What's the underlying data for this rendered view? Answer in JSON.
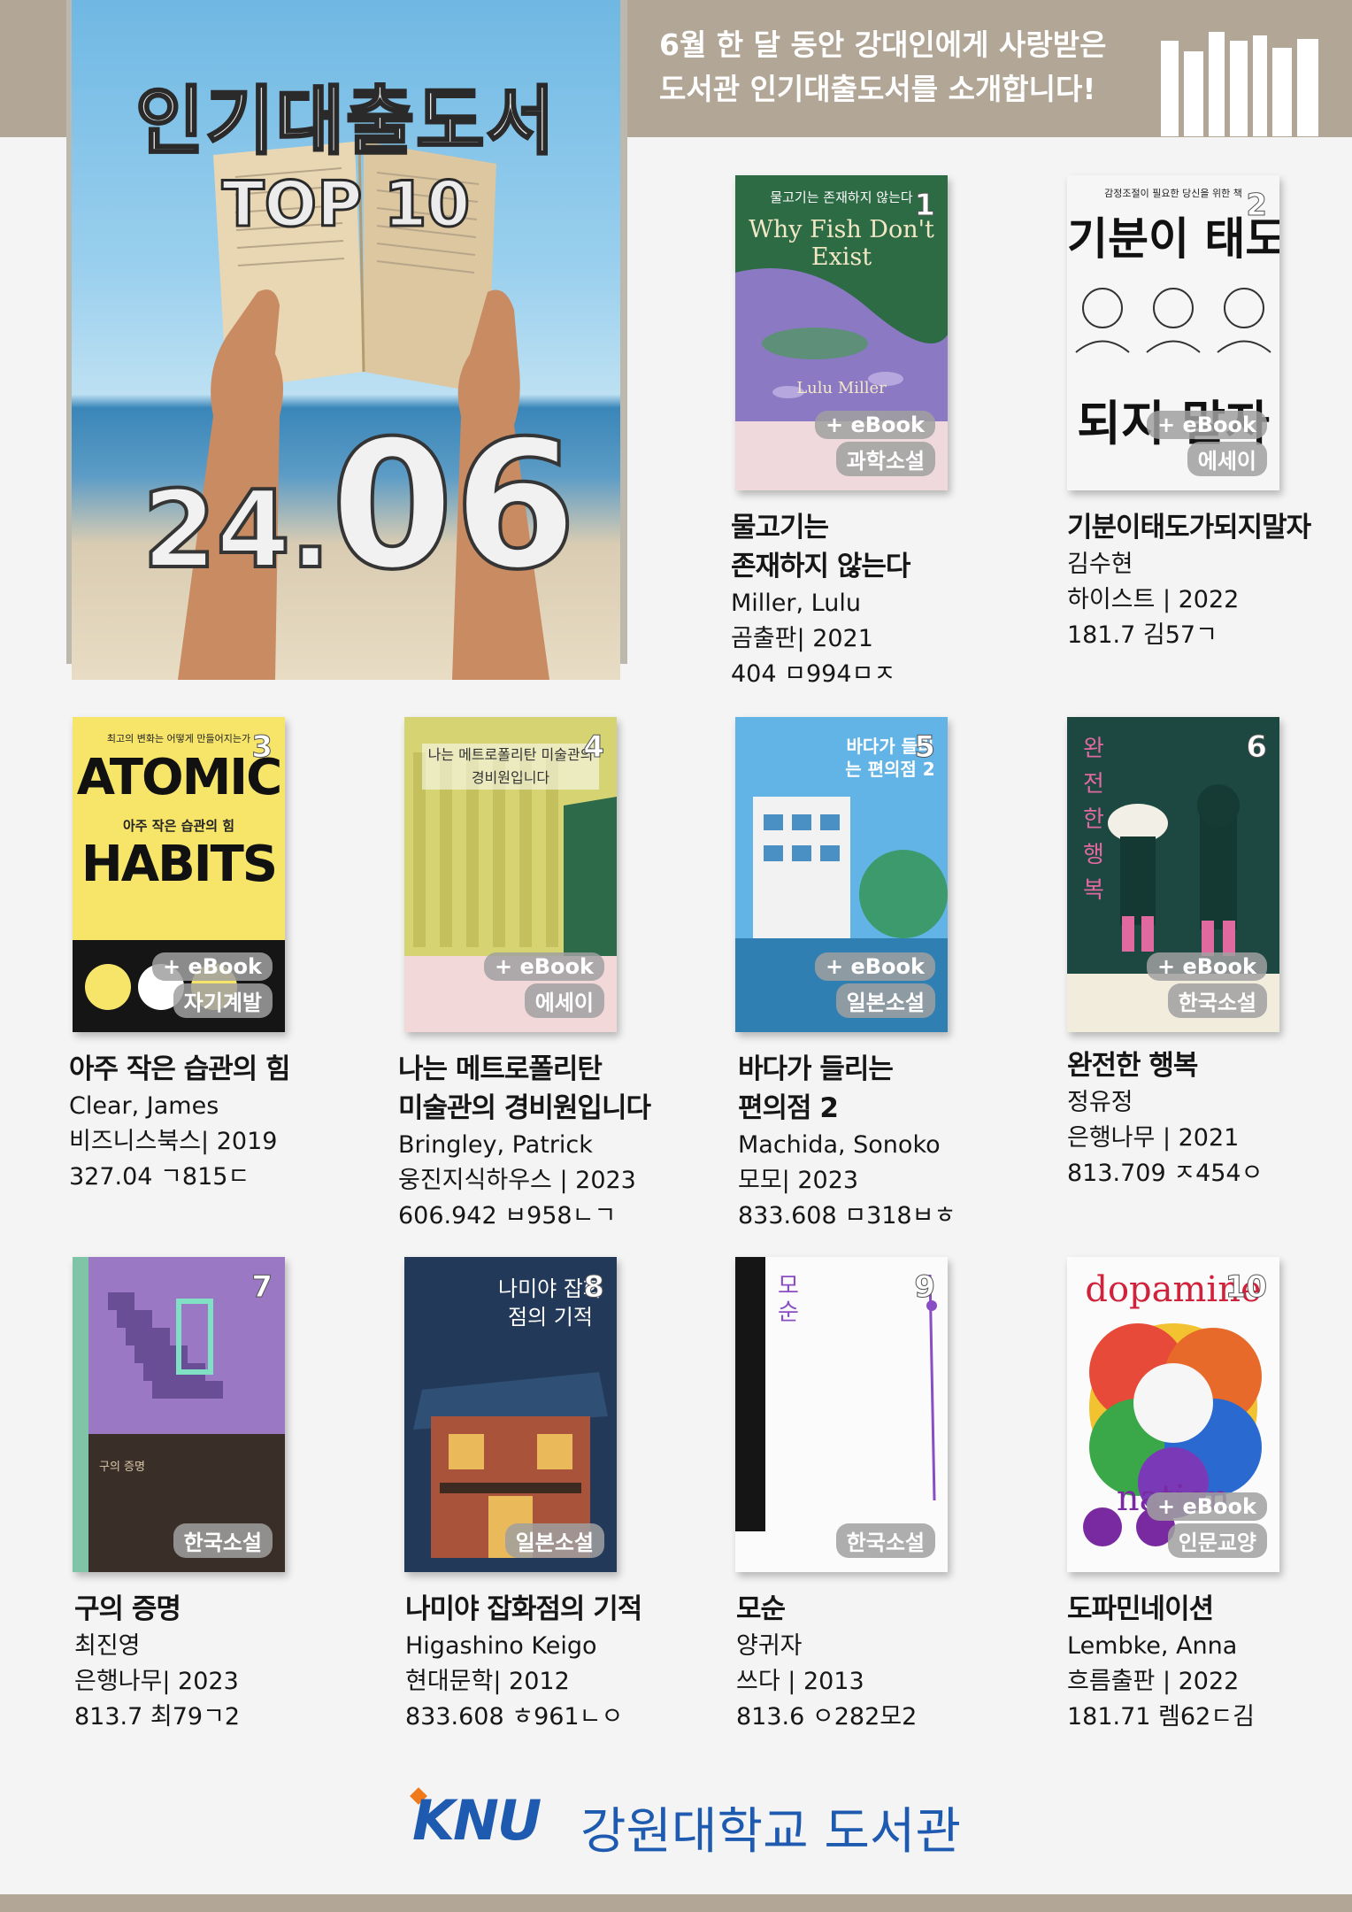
{
  "intro": {
    "line1": "6월 한 달 동안 강대인에게 사랑받은",
    "line2": "도서관 인기대출도서를 소개합니다!"
  },
  "hero": {
    "title": "인기대출도서",
    "subtitle": "TOP 10",
    "date_prefix": "24.",
    "date_month": "06"
  },
  "colors": {
    "band": "#b2a696",
    "brand": "#1d5ab0",
    "accent": "#f07a1a"
  },
  "books": [
    {
      "rank": "1",
      "title_lines": [
        "물고기는",
        "존재하지 않는다"
      ],
      "author": "Miller, Lulu",
      "publisher_year": "곰출판| 2021",
      "call_number": "404 ㅁ994ㅁㅈ",
      "ebook": "+ eBook",
      "genre": "과학소설",
      "cover_title": "Why Fish Don't Exist",
      "cover_top": "물고기는 존재하지 않는다",
      "cover_author": "Lulu Miller"
    },
    {
      "rank": "2",
      "title_lines": [
        "기분이태도가되지말자"
      ],
      "author": "김수현",
      "publisher_year": "하이스트 | 2022",
      "call_number": "181.7 김57ㄱ",
      "ebook": "+ eBook",
      "genre": "에세이",
      "cover_top": "감정조절이 필요한 당신을 위한 책",
      "cover_big1": "기분이 태도",
      "cover_big2": "되지 말자"
    },
    {
      "rank": "3",
      "title_lines": [
        "아주 작은 습관의 힘"
      ],
      "author": "Clear, James",
      "publisher_year": "비즈니스북스| 2019",
      "call_number": "327.04 ㄱ815ㄷ",
      "ebook": "+ eBook",
      "genre": "자기계발",
      "cover_top": "최고의 변화는 어떻게 만들어지는가",
      "cover_big1": "ATOMIC",
      "cover_mid": "아주 작은 습관의 힘",
      "cover_big2": "HABITS"
    },
    {
      "rank": "4",
      "title_lines": [
        "나는 메트로폴리탄",
        "미술관의 경비원입니다"
      ],
      "author": "Bringley, Patrick",
      "publisher_year": "웅진지식하우스 | 2023",
      "call_number": "606.942 ㅂ958ㄴㄱ",
      "ebook": "+ eBook",
      "genre": "에세이",
      "cover_top": "나는 메트로폴리탄 미술관의 경비원입니다"
    },
    {
      "rank": "5",
      "title_lines": [
        "바다가 들리는",
        "편의점 2"
      ],
      "author": "Machida, Sonoko",
      "publisher_year": "모모| 2023",
      "call_number": "833.608 ㅁ318ㅂㅎ",
      "ebook": "+ eBook",
      "genre": "일본소설",
      "cover_top": "바다가 들리는 편의점 2"
    },
    {
      "rank": "6",
      "title_lines": [
        "완전한 행복"
      ],
      "author": "정유정",
      "publisher_year": "은행나무 | 2021",
      "call_number": "813.709 ㅈ454ㅇ",
      "ebook": "+ eBook",
      "genre": "한국소설",
      "cover_top": "완전한 행복"
    },
    {
      "rank": "7",
      "title_lines": [
        "구의 증명"
      ],
      "author": "최진영",
      "publisher_year": "은행나무| 2023",
      "call_number": "813.7 최79ㄱ2",
      "ebook": "",
      "genre": "한국소설",
      "cover_top": "구의 증명"
    },
    {
      "rank": "8",
      "title_lines": [
        "나미야 잡화점의 기적"
      ],
      "author": "Higashino Keigo",
      "publisher_year": "현대문학| 2012",
      "call_number": "833.608 ㅎ961ㄴㅇ",
      "ebook": "",
      "genre": "일본소설",
      "cover_top": "나미야 잡화점의 기적"
    },
    {
      "rank": "9",
      "title_lines": [
        "모순"
      ],
      "author": "양귀자",
      "publisher_year": "쓰다 | 2013",
      "call_number": "813.6 ㅇ282모2",
      "ebook": "",
      "genre": "한국소설",
      "cover_top": "모순"
    },
    {
      "rank": "10",
      "title_lines": [
        "도파민네이션"
      ],
      "author": "Lembke, Anna",
      "publisher_year": "흐름출판 | 2022",
      "call_number": "181.71 렘62ㄷ김",
      "ebook": "+ eBook",
      "genre": "인문교양",
      "cover_big1": "dopamine",
      "cover_big2": "nation"
    }
  ],
  "logo": {
    "mark": "KNU",
    "name": "강원대학교 도서관"
  }
}
